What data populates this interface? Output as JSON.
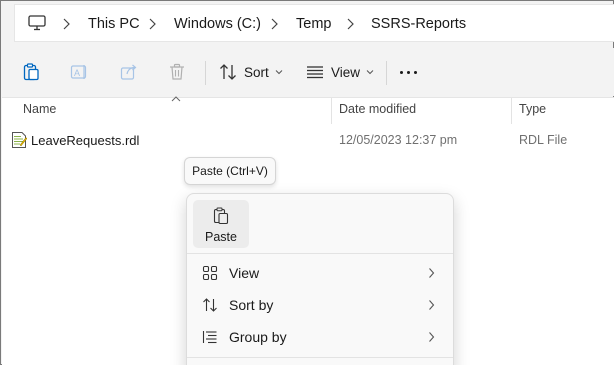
{
  "breadcrumb": {
    "root_icon": "computer-icon",
    "items": [
      "This PC",
      "Windows (C:)",
      "Temp",
      "SSRS-Reports"
    ]
  },
  "commandbar": {
    "sort_label": "Sort",
    "view_label": "View",
    "icons": [
      "paste-icon",
      "rename-icon",
      "share-icon",
      "delete-icon",
      "sort-icon",
      "view-icon",
      "more-icon"
    ]
  },
  "columns": {
    "name": "Name",
    "date_modified": "Date modified",
    "type": "Type"
  },
  "files": [
    {
      "name": "LeaveRequests.rdl",
      "date_modified": "12/05/2023 12:37 pm",
      "type": "RDL File",
      "icon": "rdl-file-icon"
    }
  ],
  "tooltip": {
    "text": "Paste (Ctrl+V)"
  },
  "context_menu": {
    "tile_label": "Paste",
    "items": [
      {
        "label": "View",
        "icon": "grid-icon"
      },
      {
        "label": "Sort by",
        "icon": "sort-icon"
      },
      {
        "label": "Group by",
        "icon": "group-icon"
      }
    ]
  },
  "colors": {
    "accent": "#0067c0",
    "disabled_icon": "#a0a0a0",
    "secondary_text": "#707070"
  }
}
